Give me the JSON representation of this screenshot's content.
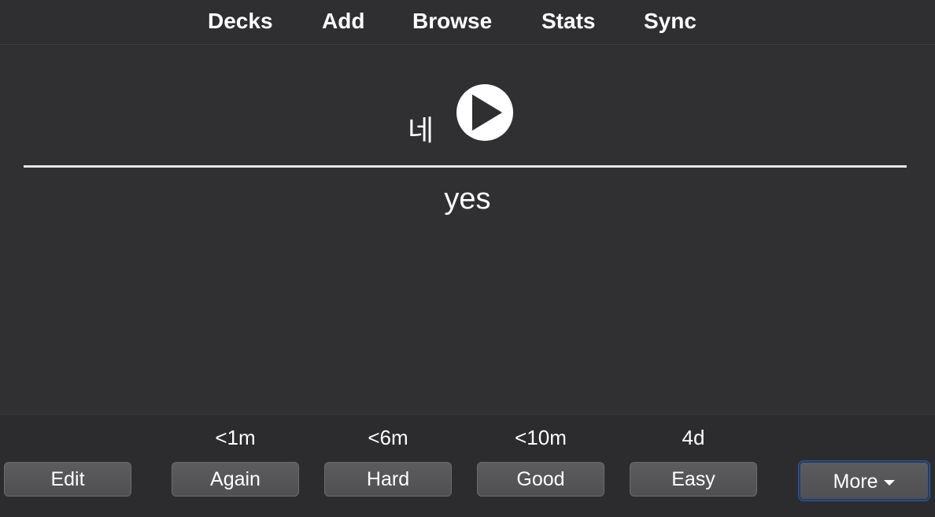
{
  "nav": {
    "decks": "Decks",
    "add": "Add",
    "browse": "Browse",
    "stats": "Stats",
    "sync": "Sync"
  },
  "card": {
    "front_text": "네",
    "audio_icon": "play-icon",
    "back_text": "yes"
  },
  "answer": {
    "intervals": {
      "again": "<1m",
      "hard": "<6m",
      "good": "<10m",
      "easy": "4d"
    },
    "buttons": {
      "edit": "Edit",
      "again": "Again",
      "hard": "Hard",
      "good": "Good",
      "easy": "Easy",
      "more": "More"
    }
  },
  "colors": {
    "background": "#2f2f31",
    "button": "#555557",
    "focus_ring": "#325a94"
  }
}
